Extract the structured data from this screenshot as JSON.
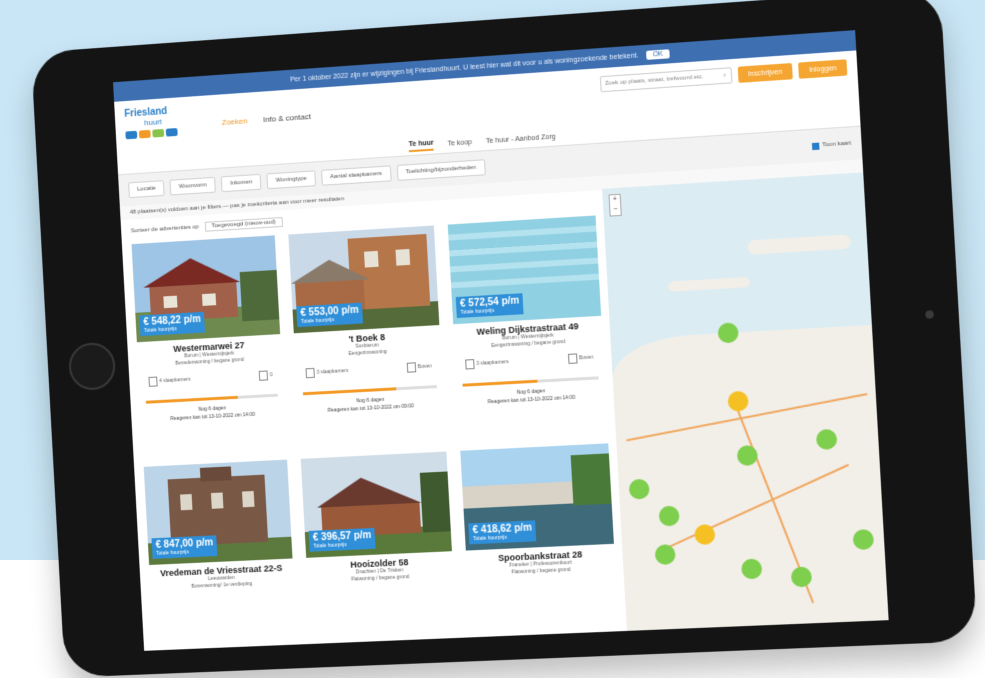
{
  "topbar": {
    "notice": "Per 1 oktober 2022 zijn er wijzigingen bij Frieslandhuurt. U leest hier wat dit voor u als woningzoekende betekent.",
    "ok_label": "OK"
  },
  "header": {
    "logo_line1": "Friesland",
    "logo_line2": "huurt",
    "nav": [
      "Zoeken",
      "Info & contact"
    ],
    "search_placeholder": "Zoek op plaats, straat, trefwoord etc.",
    "register_label": "Inschrijven",
    "login_label": "Inloggen"
  },
  "tabs": [
    "Te huur",
    "Te koop",
    "Te huur - Aanbod Zorg"
  ],
  "filters": {
    "chips": [
      "Locatie",
      "Woonvorm",
      "Inkomen",
      "Woningtype",
      "Aantal slaapkamers",
      "Toelichting/bijzonderheden"
    ],
    "map_toggle": "Toon kaart"
  },
  "results_line": "48 plaatsen(s) voldoen aan je filters — pas je zoekcriteria aan voor meer resultaten",
  "sort": {
    "label": "Sorteer de advertenties op",
    "selected": "Toegevoegd (nieuw-oud)"
  },
  "listings": [
    {
      "price": "€ 548,22 p/m",
      "price_note": "Totale huurprijs",
      "address": "Westermarwei 27",
      "place": "Burum | Westernijtsjerk",
      "type": "Benedenwoning / begane grond",
      "rooms": "4 slaapkamers",
      "floor": "0",
      "deadline": "Nog 6 dagen",
      "date": "Reageren kan tot 13-10-2022 om 14:00",
      "progress": 0.7
    },
    {
      "price": "€ 553,00 p/m",
      "price_note": "Totale huurprijs",
      "address": "'t Boek 8",
      "place": "Sexbierum",
      "type": "Eengezinswoning",
      "rooms": "3 slaapkamers",
      "floor": "Boven",
      "deadline": "Nog 6 dagen",
      "date": "Reageren kan tot 13-10-2022 om 09:00",
      "progress": 0.7
    },
    {
      "price": "€ 572,54 p/m",
      "price_note": "Totale huurprijs",
      "address": "Weling Dijkstrastraat 49",
      "place": "Burum | Westernijtsjerk",
      "type": "Eengezinswoning / begane grond",
      "rooms": "3 slaapkamers",
      "floor": "Boven",
      "deadline": "Nog 6 dagen",
      "date": "Reageren kan tot 13-10-2022 om 14:00",
      "progress": 0.55
    },
    {
      "price": "€ 847,00 p/m",
      "price_note": "Totale huurprijs",
      "address": "Vredeman de Vriesstraat 22-S",
      "place": "Leeuwarden",
      "type": "Bovenwoning/ 1e verdieping",
      "rooms": "",
      "floor": "",
      "deadline": "",
      "date": "",
      "progress": 0
    },
    {
      "price": "€ 396,57 p/m",
      "price_note": "Totale huurprijs",
      "address": "Hooizolder 58",
      "place": "Drachten | De Trisken",
      "type": "Flatwoning / begane grond",
      "rooms": "",
      "floor": "",
      "deadline": "",
      "date": "",
      "progress": 0
    },
    {
      "price": "€ 418,62 p/m",
      "price_note": "Totale huurprijs",
      "address": "Spoorbankstraat 28",
      "place": "Franeker | Professorenbuurt",
      "type": "Flatwoning / begane grond",
      "rooms": "",
      "floor": "",
      "deadline": "",
      "date": "",
      "progress": 0
    }
  ],
  "map": {
    "zoom_in": "+",
    "zoom_out": "−"
  },
  "colors": {
    "brand_blue": "#3d6fb1",
    "accent_orange": "#f39a26",
    "price_blue": "#2f8fd8",
    "cluster_green": "#7fcf4e"
  }
}
